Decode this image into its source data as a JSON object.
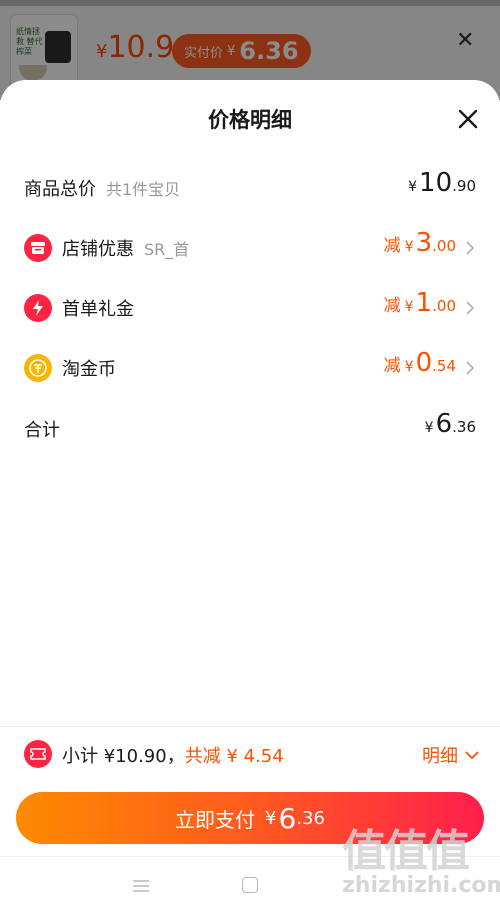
{
  "background": {
    "thumbnail_text": "纸情拯救 替代榨菜",
    "price_currency": "¥",
    "price": "10.9",
    "actual_label": "实付价",
    "actual_currency": "¥",
    "actual_price": "6.36"
  },
  "sheet": {
    "title": "价格明细",
    "rows": [
      {
        "label": "商品总价",
        "sub": "共1件宝贝",
        "prefix": "",
        "currency": "¥",
        "int": "10",
        "dec": ".90",
        "icon": "",
        "color": "dark"
      },
      {
        "label": "店铺优惠",
        "sub": "SR_首",
        "prefix": "减",
        "currency": "¥",
        "int": "3",
        "dec": ".00",
        "icon": "store-icon",
        "color": "orange"
      },
      {
        "label": "首单礼金",
        "sub": "",
        "prefix": "减",
        "currency": "¥",
        "int": "1",
        "dec": ".00",
        "icon": "lightning-icon",
        "color": "orange"
      },
      {
        "label": "淘金币",
        "sub": "",
        "prefix": "减",
        "currency": "¥",
        "int": "0",
        "dec": ".54",
        "icon": "coin-icon",
        "color": "orange"
      },
      {
        "label": "合计",
        "sub": "",
        "prefix": "",
        "currency": "¥",
        "int": "6",
        "dec": ".36",
        "icon": "",
        "color": "dark"
      }
    ]
  },
  "summary": {
    "subtotal_text": "小计 ¥10.90，",
    "reduce_text": "共减 ¥ 4.54",
    "detail_label": "明细"
  },
  "pay": {
    "label": "立即支付",
    "currency": "¥",
    "int": "6",
    "dec": ".36"
  },
  "watermark": {
    "glyphs": "值值值",
    "url": "zhizhizhi.com"
  },
  "colors": {
    "accent": "#ff5000",
    "icon_red": "#ff2442",
    "icon_gold": "#f7b500"
  }
}
